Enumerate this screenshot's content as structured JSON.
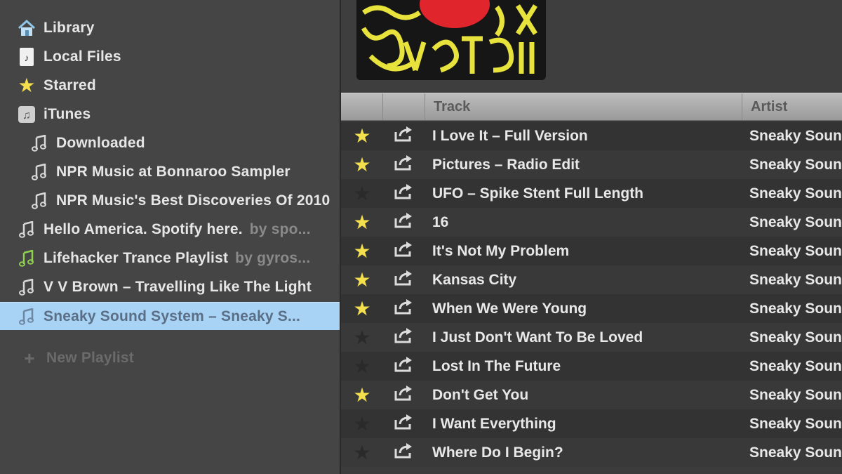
{
  "sidebar": {
    "items": [
      {
        "label": "Library",
        "owner": "",
        "icon": "home-icon",
        "indent": false
      },
      {
        "label": "Local Files",
        "owner": "",
        "icon": "local-files-icon",
        "indent": false
      },
      {
        "label": "Starred",
        "owner": "",
        "icon": "star-icon",
        "indent": false
      },
      {
        "label": "iTunes",
        "owner": "",
        "icon": "itunes-icon",
        "indent": false
      },
      {
        "label": "Downloaded",
        "owner": "",
        "icon": "music-note-icon",
        "indent": true
      },
      {
        "label": "NPR Music at Bonnaroo Sampler",
        "owner": "",
        "icon": "music-note-icon",
        "indent": true
      },
      {
        "label": "NPR Music's Best Discoveries Of 2010",
        "owner": "",
        "icon": "music-note-icon",
        "indent": true
      },
      {
        "label": "Hello America. Spotify here.",
        "owner": "by spo...",
        "icon": "music-note-icon",
        "indent": false
      },
      {
        "label": "Lifehacker Trance Playlist",
        "owner": "by gyros...",
        "icon": "music-note-icon",
        "indent": false
      },
      {
        "label": "V V Brown – Travelling Like The Light",
        "owner": "",
        "icon": "music-note-icon",
        "indent": false
      },
      {
        "label": "Sneaky Sound System – Sneaky S...",
        "owner": "",
        "icon": "music-note-icon",
        "indent": false
      }
    ],
    "selected_index": 10,
    "new_playlist_label": "New Playlist"
  },
  "tracklist": {
    "columns": {
      "track": "Track",
      "artist": "Artist"
    },
    "rows": [
      {
        "starred": true,
        "track": "I Love It – Full Version",
        "artist": "Sneaky Soun"
      },
      {
        "starred": true,
        "track": "Pictures – Radio Edit",
        "artist": "Sneaky Soun"
      },
      {
        "starred": false,
        "track": "UFO – Spike Stent Full Length",
        "artist": "Sneaky Soun"
      },
      {
        "starred": true,
        "track": "16",
        "artist": "Sneaky Soun"
      },
      {
        "starred": true,
        "track": "It's Not My Problem",
        "artist": "Sneaky Soun"
      },
      {
        "starred": true,
        "track": "Kansas City",
        "artist": "Sneaky Soun"
      },
      {
        "starred": true,
        "track": "When We Were Young",
        "artist": "Sneaky Soun"
      },
      {
        "starred": false,
        "track": "I Just Don't Want To Be Loved",
        "artist": "Sneaky Soun"
      },
      {
        "starred": false,
        "track": "Lost In The Future",
        "artist": "Sneaky Soun"
      },
      {
        "starred": true,
        "track": "Don't Get You",
        "artist": "Sneaky Soun"
      },
      {
        "starred": false,
        "track": "I Want Everything",
        "artist": "Sneaky Soun"
      },
      {
        "starred": false,
        "track": "Where Do I Begin?",
        "artist": "Sneaky Soun"
      }
    ]
  },
  "colors": {
    "star_on": "#f4e04d",
    "selected_bg": "#a9d3f5",
    "sidebar_bg": "#454545"
  }
}
